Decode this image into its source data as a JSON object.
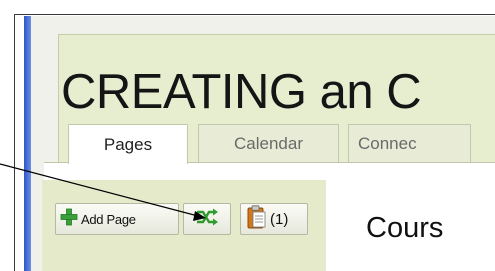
{
  "page": {
    "title": "CREATING an C",
    "tabs": [
      {
        "label": "Pages",
        "active": true
      },
      {
        "label": "Calendar",
        "active": false
      },
      {
        "label": "Connec",
        "active": false
      }
    ]
  },
  "toolbar": {
    "add_page_label": "Add Page",
    "shuffle_icon": "shuffle-icon",
    "clipboard_icon": "clipboard-icon",
    "clipboard_count": "(1)"
  },
  "main": {
    "heading": "Cours"
  },
  "colors": {
    "accent_green": "#3aa13a",
    "panel_green": "#e7edcf",
    "frame_blue": "#2f55c7"
  }
}
